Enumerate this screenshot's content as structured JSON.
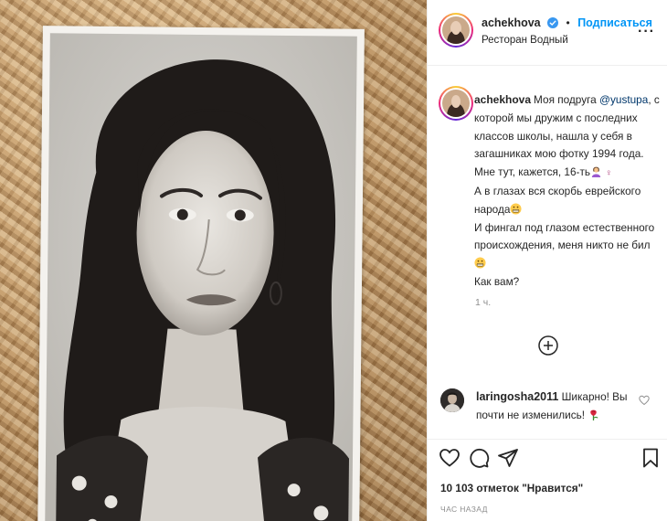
{
  "post": {
    "author": "achekhova",
    "follow_label": "Подписаться",
    "dot": "•",
    "location": "Ресторан Водный",
    "more_label": "···"
  },
  "caption": {
    "lines": [
      "Моя подруга ",
      "@yustupa",
      ", с которой мы дружим с последних классов школы, нашла у себя в загашниках мою фотку 1994 года.",
      "Мне тут, кажется, 16-ть",
      "А в глазах вся скорбь еврейского народа",
      "И фингал под глазом естественного происхождения, меня никто не бил",
      "Как вам?"
    ],
    "time": "1 ч."
  },
  "comment": {
    "user": "laringosha2011",
    "text": "Шикарно! Вы почти не изменились!"
  },
  "stats": {
    "likes": "10 103 отметок \"Нравится\"",
    "posted": "ЧАС НАЗАД"
  },
  "icons": {
    "heart": "heart-icon",
    "comment": "comment-icon",
    "share": "share-icon",
    "bookmark": "bookmark-icon",
    "add": "plus-circle-icon"
  },
  "colors": {
    "link": "#0095f6",
    "mention": "#00376b",
    "verified": "#3897f0",
    "muted": "#8e8e8e"
  }
}
